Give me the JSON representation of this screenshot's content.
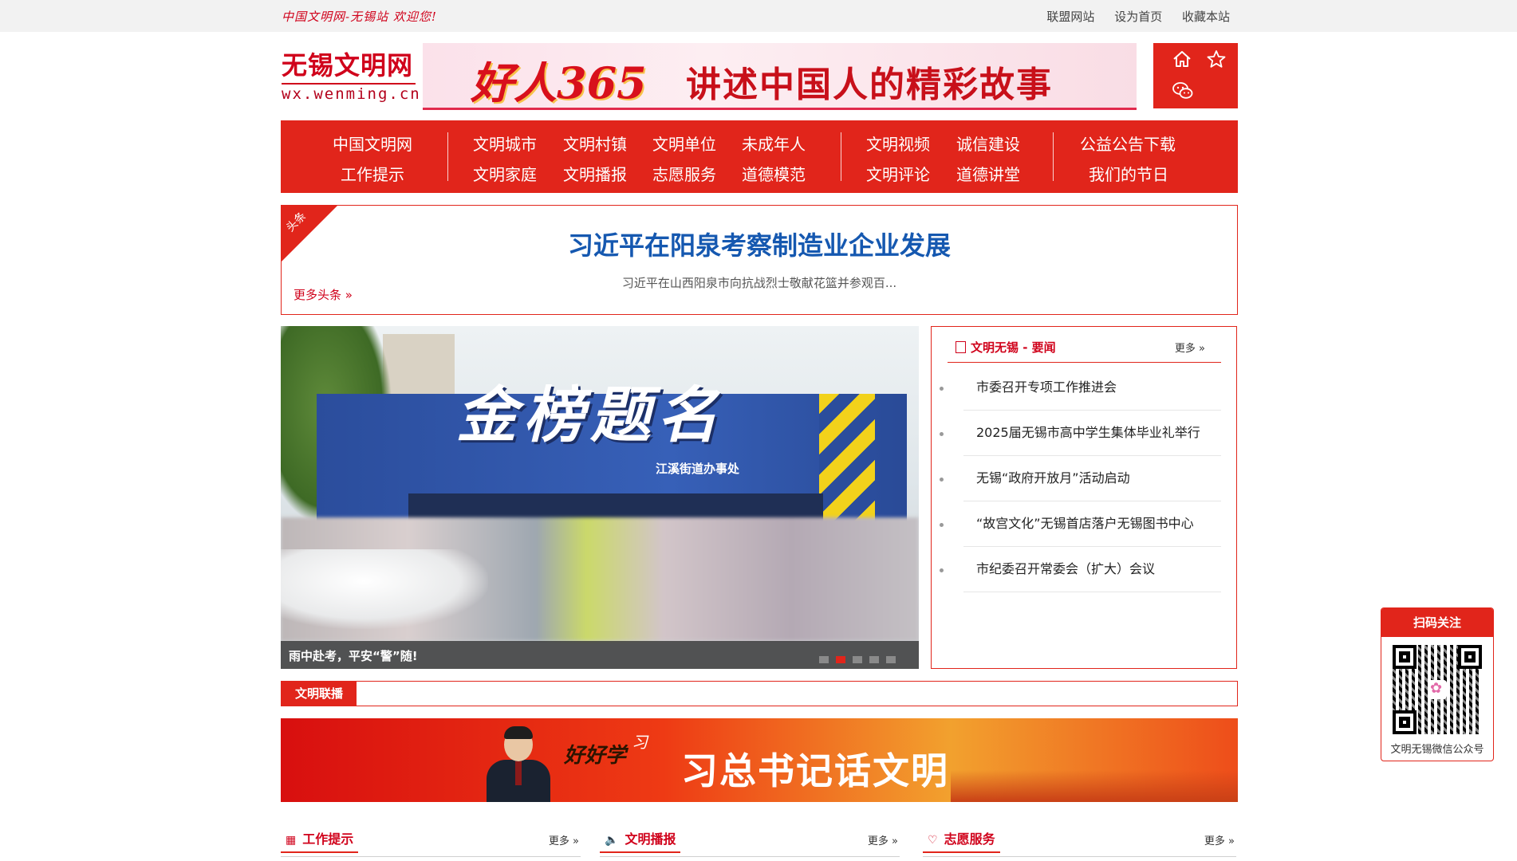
{
  "topbar": {
    "welcome": "中国文明网-无锡站 欢迎您!",
    "links": [
      "联盟网站",
      "设为首页",
      "收藏本站"
    ]
  },
  "logo": {
    "cn": "无锡文明网",
    "en": "wx.wenming.cn"
  },
  "banner365": {
    "brand": "好人365",
    "slogan": "讲述中国人的精彩故事"
  },
  "header_icons": [
    "home-icon",
    "star-icon",
    "wechat-icon"
  ],
  "nav": {
    "group1": [
      "中国文明网",
      "工作提示"
    ],
    "group2_row1": [
      "文明城市",
      "文明村镇",
      "文明单位",
      "未成年人"
    ],
    "group2_row2": [
      "文明家庭",
      "文明播报",
      "志愿服务",
      "道德模范"
    ],
    "group3_row1": [
      "文明视频",
      "诚信建设"
    ],
    "group3_row2": [
      "文明评论",
      "道德讲堂"
    ],
    "group4": [
      "公益公告下载",
      "我们的节日"
    ]
  },
  "headline": {
    "corner": "头条",
    "title": "习近平在阳泉考察制造业企业发展",
    "summary": "习近平在山西阳泉市向抗战烈士敬献花篮并参观百...",
    "more": "更多头条 »"
  },
  "slider": {
    "banner_text": "金榜题名",
    "office_text": "江溪街道办事处",
    "caption": "雨中赴考，平安“警”随!",
    "dot_count": 5,
    "active_dot": 2
  },
  "news": {
    "title": "文明无锡 - 要闻",
    "more": "更多 »",
    "items": [
      "市委召开专项工作推进会",
      "2025届无锡市高中学生集体毕业礼举行",
      "无锡“政府开放月”活动启动",
      "“故宫文化”无锡首店落户无锡图书中心",
      "市纪委召开常委会（扩大）会议"
    ]
  },
  "lianbo": {
    "tag": "文明联播"
  },
  "banner2": {
    "haohaoxue": "好好学",
    "xi": "习",
    "title": "习总书记话文明"
  },
  "sections": [
    {
      "title": "工作提示",
      "icon": "grid-icon",
      "more": "更多 »"
    },
    {
      "title": "文明播报",
      "icon": "speaker-icon",
      "more": "更多 »"
    },
    {
      "title": "志愿服务",
      "icon": "heart-icon",
      "more": "更多 »"
    }
  ],
  "qr": {
    "title": "扫码关注",
    "footer": "文明无锡微信公众号"
  },
  "colors": {
    "brand_red": "#e1251b",
    "headline_blue": "#1558b0"
  }
}
